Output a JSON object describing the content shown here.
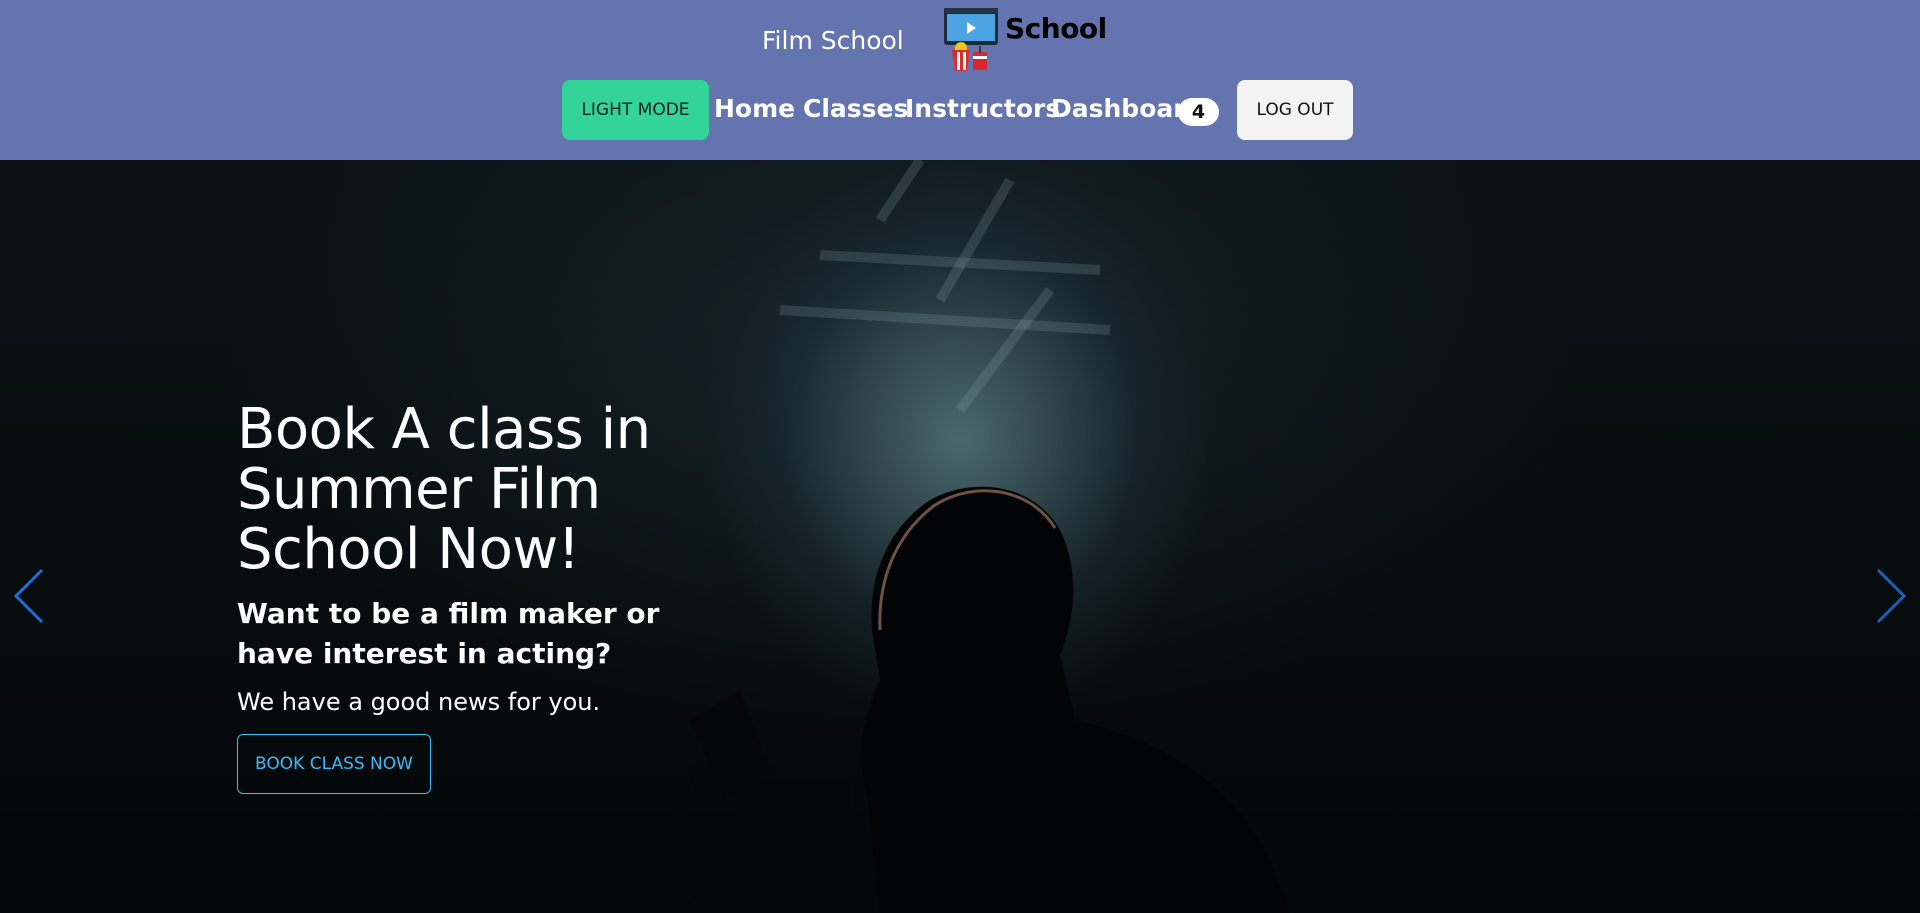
{
  "header": {
    "site_title": "Film School",
    "logo_text": "School",
    "theme_button": "LIGHT MODE",
    "nav": [
      {
        "label": "Home"
      },
      {
        "label": "Classes"
      },
      {
        "label": "Instructors"
      },
      {
        "label": "Dashboard"
      }
    ],
    "dashboard_badge": "4",
    "logout_button": "LOG OUT"
  },
  "hero": {
    "title": "Book A class in Summer Film School Now!",
    "subtitle": "Want to be a film maker or have interest in acting?",
    "note": "We have a good news for you.",
    "cta": "BOOK CLASS NOW"
  },
  "colors": {
    "header_bg": "#6474af",
    "light_mode_button": "#34d399",
    "cta_outline": "#38bdf8",
    "carousel_arrow": "#1e6fd9"
  },
  "icons": {
    "logo": "tv-popcorn-logo-icon",
    "prev": "chevron-left-icon",
    "next": "chevron-right-icon"
  }
}
